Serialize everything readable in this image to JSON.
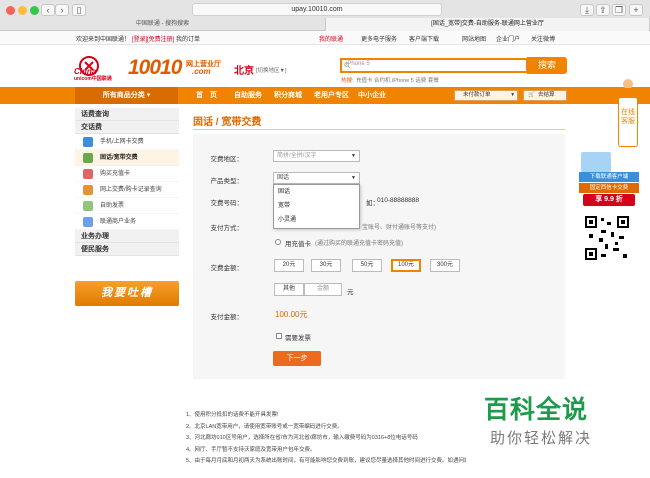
{
  "browser": {
    "url": "upay.10010.com",
    "tabs": [
      "中国联通 - 搜狗搜索",
      "[固话_宽带]交费-自助服务-联通网上营业厅"
    ]
  },
  "toplinks": {
    "welcome": "欢迎来到中国联通！",
    "login": "[登录]",
    "register": "[免费注册]",
    "orders": "我的订单",
    "my_unicom": "我的联通",
    "more_ebooks": "更多电子服务",
    "client_download": "客户端下载",
    "sitemap": "网站地图",
    "enterprise": "企业门户",
    "weibo": "关注微博"
  },
  "header": {
    "brand_top": "China",
    "brand_bottom": "unicom中国联通",
    "n10010": "10010",
    "dotcom": ".com",
    "mall_line1": "网上营业厅",
    "city": "北京",
    "city_switch": "[切换地区▼]",
    "search_placeholder": "iPhone 5",
    "search_btn": "搜索",
    "hot_label": "热搜:",
    "hot_words": "充值卡  合约机  iPhone 5  话费  套餐"
  },
  "nav": {
    "all_categories": "所有商品分类",
    "items": [
      "首　页",
      "自助服务",
      "积分商城",
      "老用户专区",
      "中小企业"
    ],
    "orders_drop": "未付款订单",
    "cart": "去结算"
  },
  "sidebar": {
    "groups": [
      {
        "title": "话费查询"
      },
      {
        "title": "交话费",
        "items": [
          "手机/上网卡交费",
          "固话/宽带交费",
          "购买充值卡",
          "网上交费/购卡记录查询",
          "自助发票",
          "联通商户业务"
        ]
      },
      {
        "title": "业务办理"
      },
      {
        "title": "便民服务"
      }
    ],
    "banner": "我要吐槽"
  },
  "main": {
    "title": "固话 / 宽带交费",
    "region_label": "交费地区：",
    "region_placeholder": "简拼/全拼/汉字",
    "product_label": "产品类型：",
    "product_value": "固话",
    "product_options": [
      "固话",
      "宽带",
      "小灵通"
    ],
    "number_label": "交费号码：",
    "number_hint_suffix": "如：",
    "number_example": "010-88888888",
    "pay_label": "支付方式：",
    "pay_hint": "宝账号、财付通账号等支付)",
    "pay_card": "用充值卡",
    "pay_card_hint": "(通过购买的联通充值卡密码充值)",
    "amount_label": "交费金额：",
    "amounts": [
      "20元",
      "30元",
      "50元",
      "100元",
      "300元"
    ],
    "other": "其他",
    "amount_input": "金额",
    "yuan": "元",
    "paid_label": "支付金额：",
    "paid_value": "100.00元",
    "invoice": "需要发票",
    "next": "下一步"
  },
  "notes": [
    "1、使用积分抵扣的话费不能开具发票!",
    "2、北京LAN宽带用户，请使用宽带账号或一宽带编码进行交费。",
    "3、河北廊坊010区号用户，选择所在省/市为河北省/廊坊市，输入缴费号码为0316+8位电话号码",
    "4、网厅、手厅暂不支持沃家庭及宽带用户包年交费。",
    "5、由于每月月底和月初两天为系统出账时间，有可能影响您交费到账，建议您尽量选择其他时间进行交费。如遇问题，请您咨询客服"
  ],
  "float": {
    "kefu": "在线客服",
    "promo1": "下载联通客户端",
    "promo2": "固定西信卡交费",
    "promo3": "享 9.9 折"
  },
  "watermark": {
    "line1": "百科全说",
    "line2": "助你轻松解决"
  }
}
